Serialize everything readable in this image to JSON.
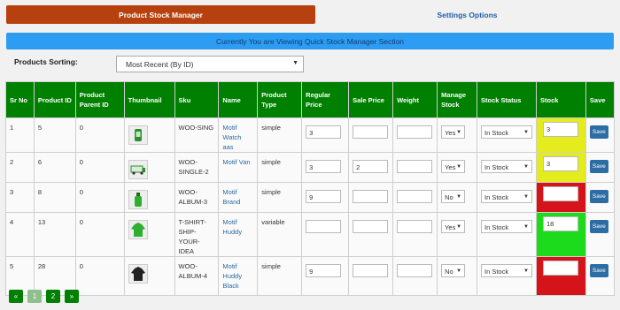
{
  "tabs": {
    "active": "Product Stock Manager",
    "other": "Settings Options"
  },
  "banner": "Currently You are Viewing Quick Stock Manager Section",
  "sorting": {
    "label": "Products Sorting:",
    "value": "Most Recent (By ID)"
  },
  "columns": [
    "Sr No",
    "Product ID",
    "Product Parent ID",
    "Thumbnail",
    "Sku",
    "Name",
    "Product Type",
    "Regular Price",
    "Sale Price",
    "Weight",
    "Manage Stock",
    "Stock Status",
    "Stock",
    "Save"
  ],
  "rows": [
    {
      "sr": "1",
      "id": "5",
      "parent": "0",
      "sku": "WOO-SING",
      "name": "Motif Watch aas",
      "type": "simple",
      "regular": "3",
      "sale": "",
      "weight": "",
      "manage": "Yes",
      "status": "In Stock",
      "stock": "3",
      "stock_color": "#e4ec1d",
      "thumb": "thumb-watch-icon",
      "save": "Save"
    },
    {
      "sr": "2",
      "id": "6",
      "parent": "0",
      "sku": "WOO-SINGLE-2",
      "name": "Motif Van",
      "type": "simple",
      "regular": "3",
      "sale": "2",
      "weight": "",
      "manage": "Yes",
      "status": "In Stock",
      "stock": "3",
      "stock_color": "#e4ec1d",
      "thumb": "thumb-van-icon",
      "save": "Save"
    },
    {
      "sr": "3",
      "id": "8",
      "parent": "0",
      "sku": "WOO-ALBUM-3",
      "name": "Motif Brand",
      "type": "simple",
      "regular": "9",
      "sale": "",
      "weight": "",
      "manage": "No",
      "status": "In Stock",
      "stock": "",
      "stock_color": "#d4141a",
      "thumb": "thumb-bottle-icon",
      "save": "Save"
    },
    {
      "sr": "4",
      "id": "13",
      "parent": "0",
      "sku": "T-SHIRT-SHIP-YOUR-IDEA",
      "name": "Motif Huddy",
      "type": "variable",
      "regular": "",
      "sale": "",
      "weight": "",
      "manage": "Yes",
      "status": "In Stock",
      "stock": "18",
      "stock_color": "#1cdb1c",
      "thumb": "thumb-hoodie-green-icon",
      "save": "Save"
    },
    {
      "sr": "5",
      "id": "28",
      "parent": "0",
      "sku": "WOO-ALBUM-4",
      "name": "Motif Huddy Black",
      "type": "simple",
      "regular": "9",
      "sale": "",
      "weight": "",
      "manage": "No",
      "status": "In Stock",
      "stock": "",
      "stock_color": "#d4141a",
      "thumb": "thumb-hoodie-black-icon",
      "save": "Save"
    }
  ],
  "pager": {
    "first": "«",
    "pages": [
      "1",
      "2"
    ],
    "last": "»",
    "active": "1"
  }
}
